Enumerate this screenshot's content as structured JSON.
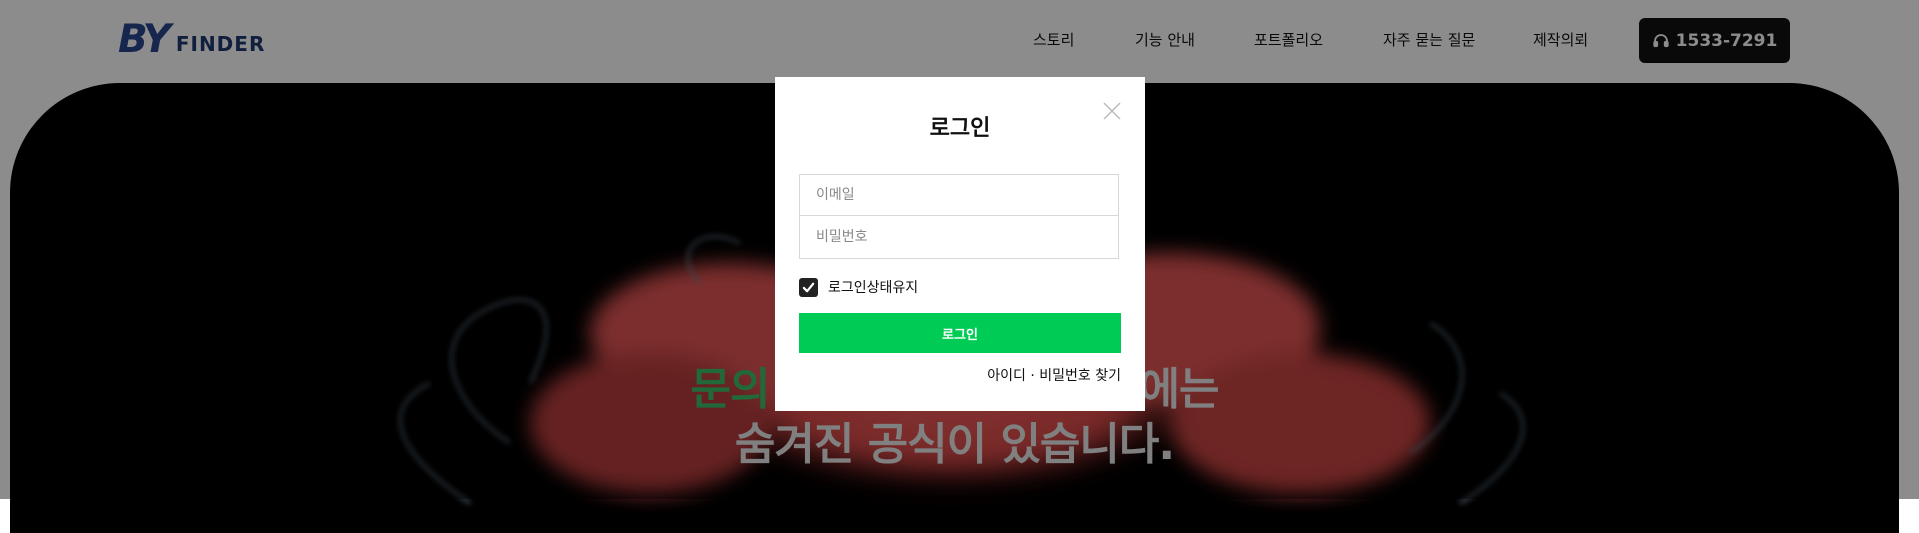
{
  "header": {
    "logo": {
      "mark": "BY",
      "text": "FINDER"
    },
    "nav": [
      {
        "label": "스토리"
      },
      {
        "label": "기능 안내"
      },
      {
        "label": "포트폴리오"
      },
      {
        "label": "자주 묻는 질문"
      },
      {
        "label": "제작의뢰"
      }
    ],
    "phone": {
      "label": "1533-7291",
      "icon": "headset-icon"
    }
  },
  "hero": {
    "line1_accent": "문의",
    "line1_rest": "에는",
    "line2": "숨겨진 공식이 있습니다."
  },
  "login_modal": {
    "title": "로그인",
    "close_icon": "close-icon",
    "email_placeholder": "이메일",
    "password_placeholder": "비밀번호",
    "remember_label": "로그인상태유지",
    "remember_checked": true,
    "submit_label": "로그인",
    "find_link": "아이디 · 비밀번호 찾기"
  },
  "colors": {
    "accent_green": "#00cc55",
    "brand_blue": "#28468f",
    "dark_button": "#111111"
  }
}
